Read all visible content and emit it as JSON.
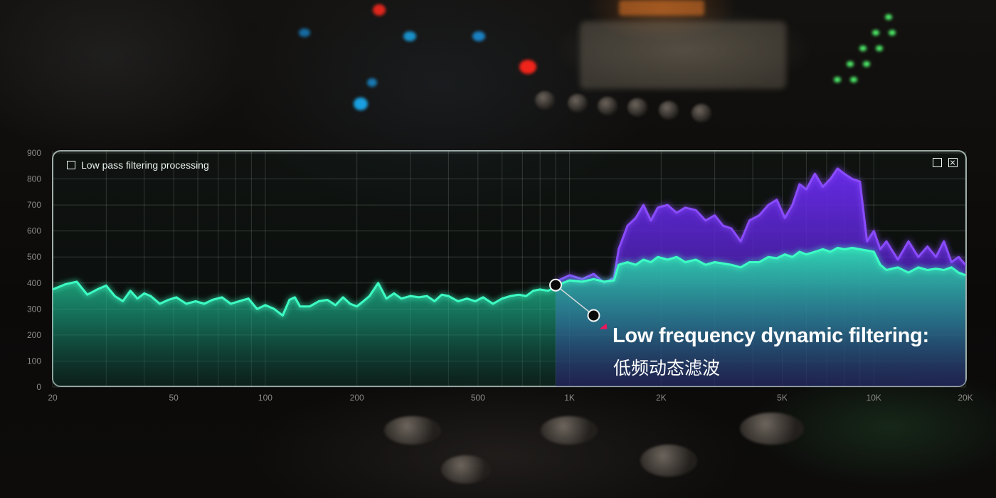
{
  "panel": {
    "title": "Low pass filtering processing"
  },
  "annotation": {
    "title": "Low frequency dynamic filtering:",
    "subtitle": "低频动态滤波"
  },
  "colors": {
    "teal": "#2af2b4",
    "purple": "#6a2cf0",
    "marker": "#e8185c"
  },
  "chart_data": {
    "type": "area",
    "x_scale": "log",
    "xlim": [
      20,
      20000
    ],
    "ylim": [
      0,
      900
    ],
    "grid": true,
    "x_ticks": [
      20,
      50,
      100,
      200,
      500,
      1000,
      2000,
      5000,
      10000,
      20000
    ],
    "x_tick_labels": [
      "20",
      "50",
      "100",
      "200",
      "500",
      "1K",
      "2K",
      "5K",
      "10K",
      "20K"
    ],
    "y_ticks": [
      0,
      100,
      200,
      300,
      400,
      500,
      600,
      700,
      800,
      900
    ],
    "y_tick_labels": [
      "0",
      "100",
      "200",
      "300",
      "400",
      "500",
      "600",
      "700",
      "800",
      "900"
    ],
    "series": [
      {
        "color": "#6a2cf0",
        "x": [
          900,
          1000,
          1100,
          1200,
          1300,
          1400,
          1450,
          1550,
          1650,
          1750,
          1850,
          1950,
          2100,
          2250,
          2400,
          2600,
          2800,
          3000,
          3200,
          3400,
          3650,
          3900,
          4200,
          4500,
          4800,
          5100,
          5400,
          5700,
          6000,
          6400,
          6800,
          7200,
          7600,
          8000,
          8500,
          9000,
          9500,
          10000,
          10500,
          11000,
          12000,
          13000,
          14000,
          15000,
          16000,
          17000,
          18000,
          19000,
          20000
        ],
        "y": [
          405,
          430,
          415,
          435,
          400,
          420,
          530,
          620,
          650,
          700,
          640,
          690,
          700,
          670,
          690,
          680,
          640,
          660,
          620,
          610,
          560,
          640,
          660,
          700,
          720,
          650,
          700,
          780,
          760,
          820,
          770,
          800,
          840,
          820,
          800,
          790,
          560,
          600,
          530,
          560,
          490,
          560,
          500,
          540,
          500,
          560,
          480,
          500,
          470
        ]
      },
      {
        "color": "#2af2b4",
        "x": [
          20,
          22,
          24,
          26,
          28,
          30,
          32,
          34,
          36,
          38,
          40,
          42,
          45,
          48,
          51,
          55,
          59,
          63,
          67,
          72,
          77,
          82,
          88,
          94,
          100,
          107,
          114,
          120,
          125,
          130,
          140,
          150,
          160,
          170,
          180,
          190,
          200,
          210,
          220,
          235,
          250,
          265,
          280,
          300,
          320,
          340,
          360,
          380,
          400,
          430,
          460,
          490,
          520,
          560,
          600,
          640,
          680,
          720,
          760,
          800,
          850,
          900,
          950,
          1000,
          1100,
          1200,
          1300,
          1400,
          1450,
          1550,
          1650,
          1750,
          1850,
          1950,
          2100,
          2250,
          2400,
          2600,
          2800,
          3000,
          3200,
          3400,
          3650,
          3900,
          4200,
          4500,
          4800,
          5100,
          5400,
          5700,
          6000,
          6400,
          6800,
          7200,
          7600,
          8000,
          8500,
          9000,
          9500,
          10000,
          10500,
          11000,
          12000,
          13000,
          14000,
          15000,
          16000,
          17000,
          18000,
          19000,
          20000
        ],
        "y": [
          375,
          395,
          405,
          355,
          375,
          390,
          350,
          330,
          370,
          340,
          360,
          350,
          320,
          335,
          345,
          320,
          330,
          320,
          335,
          345,
          320,
          330,
          340,
          300,
          315,
          300,
          275,
          335,
          345,
          310,
          310,
          330,
          335,
          315,
          345,
          320,
          310,
          330,
          350,
          400,
          340,
          360,
          340,
          350,
          345,
          350,
          330,
          355,
          350,
          330,
          340,
          330,
          345,
          320,
          340,
          350,
          355,
          350,
          370,
          375,
          370,
          385,
          400,
          410,
          405,
          415,
          405,
          410,
          470,
          480,
          470,
          490,
          480,
          500,
          490,
          500,
          480,
          490,
          470,
          480,
          475,
          470,
          460,
          480,
          480,
          500,
          495,
          510,
          500,
          520,
          510,
          520,
          530,
          520,
          535,
          530,
          535,
          530,
          525,
          520,
          470,
          450,
          460,
          440,
          460,
          450,
          455,
          450,
          460,
          440,
          430
        ]
      }
    ],
    "markers": [
      {
        "x": 900,
        "y": 392
      },
      {
        "x": 1200,
        "y": 275
      }
    ]
  }
}
